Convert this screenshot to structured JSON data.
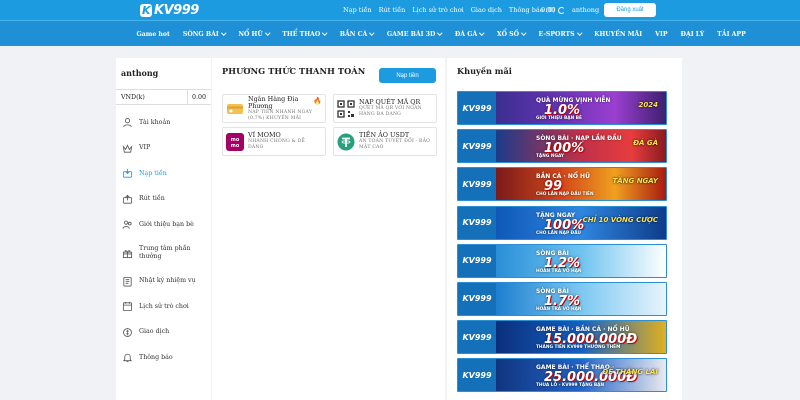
{
  "brand": {
    "logo_text": "KV999",
    "accent": "#1d9be0",
    "nav_bg": "#1f8fd6"
  },
  "topbar": {
    "links": [
      "Nạp tiền",
      "Rút tiền",
      "Lịch sử trò chơi",
      "Giao dịch",
      "Thông báo (0)"
    ],
    "balance": "0.00",
    "username": "anthong",
    "logout": "Đăng xuất"
  },
  "nav": {
    "items": [
      {
        "label": "Game hot",
        "dropdown": false
      },
      {
        "label": "SÒNG BÀI",
        "dropdown": true
      },
      {
        "label": "NỔ HŨ",
        "dropdown": true
      },
      {
        "label": "THỂ THAO",
        "dropdown": true
      },
      {
        "label": "BẮN CÁ",
        "dropdown": true
      },
      {
        "label": "GAME BÀI 3D",
        "dropdown": true
      },
      {
        "label": "ĐÁ GÀ",
        "dropdown": true
      },
      {
        "label": "XỔ SỐ",
        "dropdown": true
      },
      {
        "label": "E-SPORTS",
        "dropdown": true
      },
      {
        "label": "KHUYẾN MÃI",
        "dropdown": false
      },
      {
        "label": "VIP",
        "dropdown": false
      },
      {
        "label": "ĐẠI LÝ",
        "dropdown": false
      },
      {
        "label": "TẢI APP",
        "dropdown": false
      }
    ]
  },
  "sidebar": {
    "username": "anthong",
    "wallet_currency": "VND(k)",
    "wallet_balance": "0.00",
    "items": [
      {
        "label": "Tài khoản",
        "icon": "user-icon",
        "active": false,
        "tall": false
      },
      {
        "label": "VIP",
        "icon": "vip-icon",
        "active": false,
        "tall": false
      },
      {
        "label": "Nạp tiền",
        "icon": "deposit-icon",
        "active": true,
        "tall": false
      },
      {
        "label": "Rút tiền",
        "icon": "withdraw-icon",
        "active": false,
        "tall": false
      },
      {
        "label": "Giới thiệu bạn bè",
        "icon": "referral-icon",
        "active": false,
        "tall": false
      },
      {
        "label": "Trung tâm phần thưởng",
        "icon": "gift-icon",
        "active": false,
        "tall": true
      },
      {
        "label": "Nhật ký nhiệm vụ",
        "icon": "task-icon",
        "active": false,
        "tall": false
      },
      {
        "label": "Lịch sử trò chơi",
        "icon": "history-icon",
        "active": false,
        "tall": false
      },
      {
        "label": "Giao dịch",
        "icon": "transaction-icon",
        "active": false,
        "tall": false
      },
      {
        "label": "Thông báo",
        "icon": "notification-icon",
        "active": false,
        "tall": false
      }
    ]
  },
  "payment": {
    "title": "PHƯƠNG THỨC THANH TOÁN",
    "tab": "Nạp tiền",
    "methods": [
      {
        "name": "Ngân Hàng Địa Phương",
        "desc": "NẠP TIỀN NHANH NGAY (0.7%) KHUYẾN MÃI",
        "icon": "bank-card-icon",
        "hot": true
      },
      {
        "name": "NẠP QUÉT MÃ QR",
        "desc": "QUÉT MÃ QR VỚI NGÂN HÀNG ĐA DẠNG",
        "icon": "qr-code-icon",
        "hot": false
      },
      {
        "name": "VÍ MOMO",
        "desc": "NHANH CHÓNG & DỄ DÀNG",
        "icon": "momo-icon",
        "hot": false
      },
      {
        "name": "TIỀN ẢO USDT",
        "desc": "AN TOÀN TUYỆT ĐỐI - BẢO MẬT CAO",
        "icon": "usdt-icon",
        "hot": false
      }
    ]
  },
  "promo": {
    "title": "Khuyến mãi",
    "banners": [
      {
        "head": "QUÀ MỪNG VỊNH VIỄN",
        "big": "1.0%",
        "sub": "GIỚI THIỆU BẠN BÈ",
        "tag": "2024",
        "style": "bg1"
      },
      {
        "head": "SÒNG BÀI · NẠP LẦN ĐẦU",
        "big": "100%",
        "sub": "TẶNG NGAY",
        "tag": "ĐÁ GÀ",
        "style": "bg2"
      },
      {
        "head": "BẮN CÁ · NỔ HŨ",
        "big": "99",
        "sub": "CHO LẦN NẠP ĐẦU TIÊN",
        "tag": "TẶNG NGAY",
        "style": "bg3"
      },
      {
        "head": "TẶNG NGAY",
        "big": "100%",
        "sub": "CHO LẦN NẠP ĐẦU",
        "tag": "CHỈ 10 VÒNG CƯỢC",
        "style": "bg4"
      },
      {
        "head": "SÒNG BÀI",
        "big": "1.2%",
        "sub": "HOÀN TRẢ VÔ HẠN",
        "tag": "",
        "style": "bg5"
      },
      {
        "head": "SÒNG BÀI",
        "big": "1.7%",
        "sub": "HOÀN TRẢ VÔ HẠN",
        "tag": "",
        "style": "bg6"
      },
      {
        "head": "GAME BÀI · BẮN CÁ · NỔ HŨ",
        "big": "15.000.000Đ",
        "sub": "THĂNG TIẾN KV999 THƯỞNG THÊM",
        "tag": "",
        "style": "bg7"
      },
      {
        "head": "GAME BÀI · THỂ THAO",
        "big": "25.000.000Đ",
        "sub": "THUA LỖ - KV999 TẶNG BẠN",
        "tag": "ĐỂ THẮNG LẠI",
        "style": "bg8"
      }
    ]
  }
}
